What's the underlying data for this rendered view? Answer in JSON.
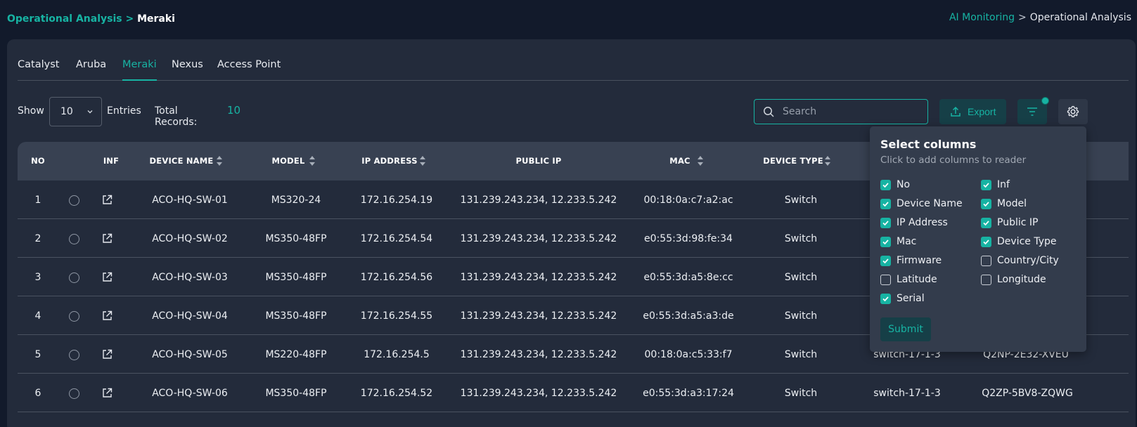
{
  "breadcrumb_left": {
    "parent": "Operational Analysis",
    "separator": ">",
    "current": "Meraki"
  },
  "breadcrumb_right": {
    "parent": "AI Monitoring",
    "separator": ">",
    "current": "Operational Analysis"
  },
  "tabs": [
    {
      "label": "Catalyst",
      "active": false
    },
    {
      "label": "Aruba",
      "active": false
    },
    {
      "label": "Meraki",
      "active": true
    },
    {
      "label": "Nexus",
      "active": false
    },
    {
      "label": "Access Point",
      "active": false
    }
  ],
  "toolbar": {
    "show_label": "Show",
    "page_size": "10",
    "entries_label": "Entries",
    "total_label": "Total Records:",
    "total_value": "10",
    "search_placeholder": "Search",
    "export_label": "Export"
  },
  "table": {
    "headers": {
      "no": "NO",
      "inf": "INF",
      "device_name": "DEVICE NAME",
      "model": "MODEL",
      "ip": "IP ADDRESS",
      "public_ip": "PUBLIC IP",
      "mac": "MAC",
      "device_type": "DEVICE TYPE"
    },
    "rows": [
      {
        "no": "1",
        "name": "ACO-HQ-SW-01",
        "model": "MS320-24",
        "ip": "172.16.254.19",
        "public_ip": "131.239.243.234, 12.233.5.242",
        "mac": "00:18:0a:c7:a2:ac",
        "type": "Switch",
        "firmware": "",
        "serial": ""
      },
      {
        "no": "2",
        "name": "ACO-HQ-SW-02",
        "model": "MS350-48FP",
        "ip": "172.16.254.54",
        "public_ip": "131.239.243.234, 12.233.5.242",
        "mac": "e0:55:3d:98:fe:34",
        "type": "Switch",
        "firmware": "",
        "serial": ""
      },
      {
        "no": "3",
        "name": "ACO-HQ-SW-03",
        "model": "MS350-48FP",
        "ip": "172.16.254.56",
        "public_ip": "131.239.243.234, 12.233.5.242",
        "mac": "e0:55:3d:a5:8e:cc",
        "type": "Switch",
        "firmware": "",
        "serial": ""
      },
      {
        "no": "4",
        "name": "ACO-HQ-SW-04",
        "model": "MS350-48FP",
        "ip": "172.16.254.55",
        "public_ip": "131.239.243.234, 12.233.5.242",
        "mac": "e0:55:3d:a5:a3:de",
        "type": "Switch",
        "firmware": "",
        "serial": ""
      },
      {
        "no": "5",
        "name": "ACO-HQ-SW-05",
        "model": "MS220-48FP",
        "ip": "172.16.254.5",
        "public_ip": "131.239.243.234, 12.233.5.242",
        "mac": "00:18:0a:c5:33:f7",
        "type": "Switch",
        "firmware": "switch-17-1-3",
        "serial": "Q2NP-2E32-XVEU"
      },
      {
        "no": "6",
        "name": "ACO-HQ-SW-06",
        "model": "MS350-48FP",
        "ip": "172.16.254.52",
        "public_ip": "131.239.243.234, 12.233.5.242",
        "mac": "e0:55:3d:a3:17:24",
        "type": "Switch",
        "firmware": "switch-17-1-3",
        "serial": "Q2ZP-5BV8-ZQWG"
      }
    ]
  },
  "column_picker": {
    "title": "Select columns",
    "subtitle": "Click to add columns to reader",
    "options": [
      {
        "label": "No",
        "checked": true
      },
      {
        "label": "Inf",
        "checked": true
      },
      {
        "label": "Device Name",
        "checked": true
      },
      {
        "label": "Model",
        "checked": true
      },
      {
        "label": "IP Address",
        "checked": true
      },
      {
        "label": "Public IP",
        "checked": true
      },
      {
        "label": "Mac",
        "checked": true
      },
      {
        "label": "Device Type",
        "checked": true
      },
      {
        "label": "Firmware",
        "checked": true
      },
      {
        "label": "Country/City",
        "checked": false
      },
      {
        "label": "Latitude",
        "checked": false
      },
      {
        "label": "Longitude",
        "checked": false
      },
      {
        "label": "Serial",
        "checked": true
      }
    ],
    "submit_label": "Submit"
  },
  "colors": {
    "accent": "#17b3a3",
    "background": "#121a2b",
    "card": "#232b3b",
    "header": "#384152",
    "popup": "#333c4c"
  },
  "icons": {
    "search": "search-icon",
    "export": "upload-icon",
    "filter": "filter-icon",
    "settings": "gear-icon",
    "external": "external-link-icon",
    "sort": "sort-icon",
    "select": "chevron-down-icon"
  }
}
